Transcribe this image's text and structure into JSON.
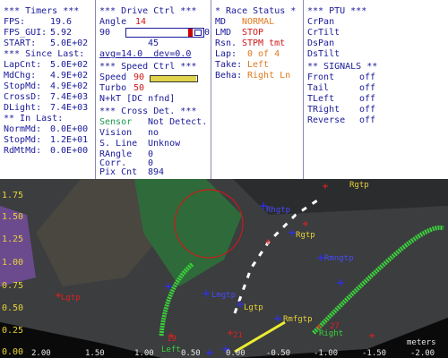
{
  "timers": {
    "header": "*** Timers ***",
    "fps_label": "FPS:",
    "fps_value": "19.6",
    "fpsgui_label": "FPS_GUI:",
    "fpsgui_value": "5.92",
    "start_label": "START:",
    "start_value": "5.0E+02",
    "since_header": "*** Since Last:",
    "lapcnt_label": "LapCnt:",
    "lapcnt_value": "5.0E+02",
    "mdchg_label": "MdChg:",
    "mdchg_value": "4.9E+02",
    "stopmd_label": "StopMd:",
    "stopmd_value": "4.9E+02",
    "crossd_label": "CrossD:",
    "crossd_value": "7.4E+03",
    "dlight_label": "DLight:",
    "dlight_value": "7.4E+03",
    "inlast_header": "** In Last:",
    "normmd_label": "NormMd:",
    "normmd_value": "0.0E+00",
    "stopmd2_label": "StopMd:",
    "stopmd2_value": "1.2E+01",
    "rdmtmd_label": "RdMtMd:",
    "rdmtmd_value": "0.0E+00"
  },
  "drive": {
    "header": "*** Drive Ctrl ***",
    "angle_label": "Angle",
    "angle_value": "14",
    "slider_min": "90",
    "slider_max": "0",
    "slider_mid": "45",
    "avg_text": "avg=14.0  dev=0.0",
    "slider_fraction": 0.85
  },
  "speed": {
    "header": "*** Speed Ctrl ***",
    "speed_label": "Speed",
    "speed_value": "90",
    "turbo_label": "Turbo",
    "turbo_value": "50",
    "nkt_text": "N+kT [DC nfnd]",
    "speed_fraction": 0.99
  },
  "crossdet": {
    "header": "*** Cross Det. ***",
    "sensor_label": "Sensor",
    "sensor_value": "Not Detect.",
    "vision_label": "Vision",
    "vision_value": "no",
    "sline_label": "S. Line",
    "sline_value": "Unknow",
    "rangle_label": "RAngle",
    "rangle_value": "0",
    "corr_label": "Corr.",
    "corr_value": "0",
    "pixcnt_label": "Pix Cnt",
    "pixcnt_value": "894"
  },
  "race": {
    "header": "* Race Status *",
    "md_label": "MD",
    "md_value": "NORMAL",
    "lmd_label": "LMD",
    "lmd_value": "STOP",
    "rsn_label": "Rsn.",
    "rsn_value": "STPM tmt",
    "lap_label": "Lap:",
    "lap_value": "0 of 4",
    "take_label": "Take:",
    "take_value": "Left",
    "beha_label": "Beha:",
    "beha_value": "Right Ln"
  },
  "ptu": {
    "header": "*** PTU ***",
    "items": [
      "CrPan",
      "CrTilt",
      "DsPan",
      "DsTilt"
    ]
  },
  "signals": {
    "header": "** SIGNALS **",
    "front_label": "Front",
    "front_value": "off",
    "tail_label": "Tail",
    "tail_value": "off",
    "tleft_label": "TLeft",
    "tleft_value": "off",
    "tright_label": "TRight",
    "tright_value": "off",
    "reverse_label": "Reverse",
    "reverse_value": "off"
  },
  "camera": {
    "y_ticks": [
      "1.75",
      "1.50",
      "1.25",
      "1.00",
      "0.75",
      "0.50",
      "0.25",
      "0.00"
    ],
    "x_ticks": [
      "2.00",
      "1.50",
      "1.00",
      "0.50",
      "0.00",
      "-0.50",
      "-1.00",
      "-1.50",
      "-2.00"
    ],
    "x_unit": "meters",
    "labels": {
      "rgtp_top": "Rgtp",
      "rhgtp": "Rhgtp",
      "rgtp_mid": "Rgtp",
      "rmngtp": "Rmngtp",
      "lmgtp": "Lmgtp",
      "lgtp": "Lgtp",
      "rmfgtp": "Rmfgtp",
      "lgtp_left": "Lgtp",
      "r27": "27",
      "right": "Right",
      "l19": "19",
      "left": "Left",
      "l21": "21"
    }
  },
  "colors": {
    "accent_text": "#1a1a9a",
    "alert_red": "#d01818",
    "warn_orange": "#e07a20",
    "ok_green": "#1a9a4a",
    "lane_green": "#3ad23a",
    "axis_yellow": "#e8d23a"
  }
}
